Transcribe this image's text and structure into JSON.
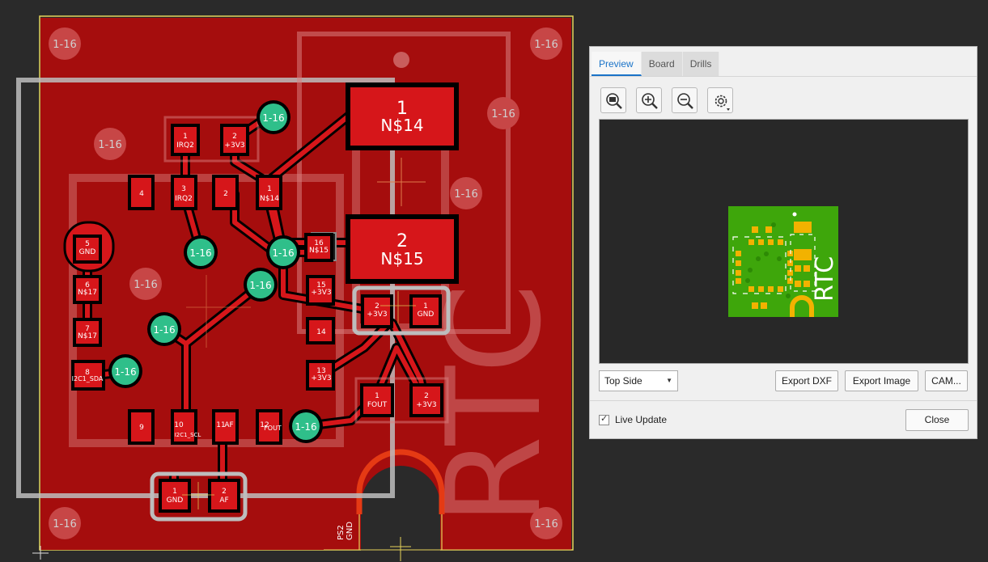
{
  "board": {
    "hole_label": "1-16",
    "pads": {
      "n14": {
        "num": "1",
        "name": "N$14"
      },
      "n15": {
        "num": "2",
        "name": "N$15"
      }
    },
    "smd": {
      "irq2_1": {
        "num": "1",
        "name": "IRQ2"
      },
      "v3_2": {
        "num": "2",
        "name": "+3V3"
      },
      "ic4": {
        "num": "4",
        "name": ""
      },
      "ic3": {
        "num": "3",
        "name": "IRQ2"
      },
      "ic2": {
        "num": "2",
        "name": ""
      },
      "ic1": {
        "num": "1",
        "name": "N$14"
      },
      "ic5": {
        "num": "5",
        "name": "GND"
      },
      "ic6": {
        "num": "6",
        "name": "N$17"
      },
      "ic7": {
        "num": "7",
        "name": "N$17"
      },
      "ic8": {
        "num": "8",
        "name": "I2C1_SDA"
      },
      "ic9": {
        "num": "9",
        "name": ""
      },
      "ic10": {
        "num": "10",
        "name": "I2C1_SCL"
      },
      "ic11": {
        "num": "11",
        "name": "AF"
      },
      "ic12": {
        "num": "12",
        "name": "FOUT"
      },
      "ic13": {
        "num": "13",
        "name": "+3V3"
      },
      "ic14": {
        "num": "14",
        "name": ""
      },
      "ic15": {
        "num": "15",
        "name": "+3V3"
      },
      "ic16": {
        "num": "16",
        "name": "N$15"
      },
      "j3v3": {
        "num": "2",
        "name": "+3V3"
      },
      "jgnd": {
        "num": "1",
        "name": "GND"
      },
      "fout": {
        "num": "1",
        "name": "FOUT"
      },
      "fout3v3": {
        "num": "2",
        "name": "+3V3"
      },
      "gnd1": {
        "num": "1",
        "name": "GND"
      },
      "af2": {
        "num": "2",
        "name": "AF"
      }
    },
    "ps2": {
      "name": "PS2",
      "net": "GND"
    },
    "silkscreen_text": "RTC"
  },
  "dialog": {
    "tabs": [
      "Preview",
      "Board",
      "Drills"
    ],
    "active_tab": "Preview",
    "toolbar": [
      "zoom-fit-icon",
      "zoom-in-icon",
      "zoom-out-icon",
      "settings-icon"
    ],
    "side_select": "Top Side",
    "buttons": {
      "export_dxf": "Export DXF",
      "export_image": "Export Image",
      "cam": "CAM..."
    },
    "live_update": {
      "label": "Live Update",
      "checked": true
    },
    "close": "Close",
    "preview_text": "RTC"
  },
  "colors": {
    "board_red": "#a50d0d",
    "copper": "#c9131a",
    "trace": "#d6161a",
    "via": "#2fbf8a",
    "preview_green": "#3ea60b",
    "preview_pad": "#f2b200",
    "accent": "#1a73c8"
  }
}
